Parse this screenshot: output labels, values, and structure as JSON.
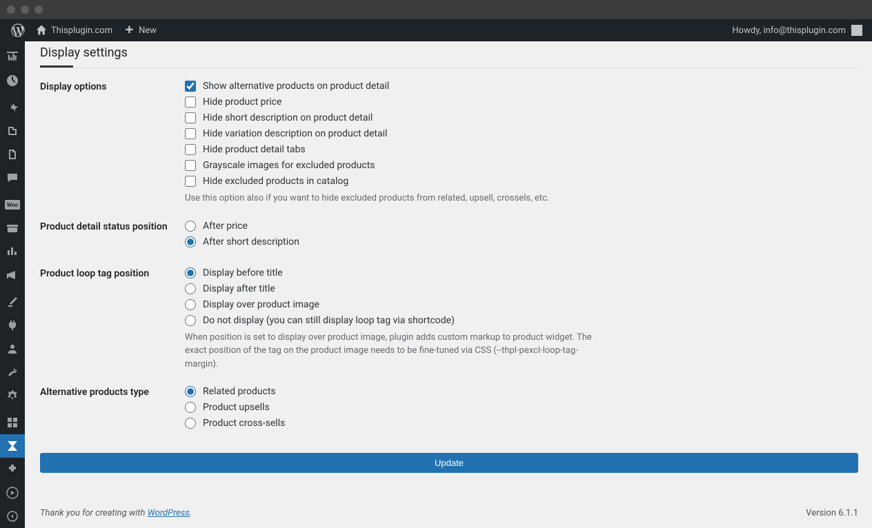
{
  "chrome": {},
  "adminbar": {
    "site_name": "Thisplugin.com",
    "new_label": "New",
    "howdy": "Howdy, info@thisplugin.com"
  },
  "page": {
    "section_title": "Display settings",
    "display_options": {
      "label": "Display options",
      "items": [
        {
          "label": "Show alternative products on product detail",
          "checked": true
        },
        {
          "label": "Hide product price",
          "checked": false
        },
        {
          "label": "Hide short description on product detail",
          "checked": false
        },
        {
          "label": "Hide variation description on product detail",
          "checked": false
        },
        {
          "label": "Hide product detail tabs",
          "checked": false
        },
        {
          "label": "Grayscale images for excluded products",
          "checked": false
        },
        {
          "label": "Hide excluded products in catalog",
          "checked": false
        }
      ],
      "help": "Use this option also if you want to hide excluded products from related, upsell, crossels, etc."
    },
    "detail_status": {
      "label": "Product detail status position",
      "options": [
        {
          "label": "After price",
          "checked": false
        },
        {
          "label": "After short description",
          "checked": true
        }
      ]
    },
    "loop_tag": {
      "label": "Product loop tag position",
      "options": [
        {
          "label": "Display before title",
          "checked": true
        },
        {
          "label": "Display after title",
          "checked": false
        },
        {
          "label": "Display over product image",
          "checked": false
        },
        {
          "label": "Do not display (you can still display loop tag via shortcode)",
          "checked": false
        }
      ],
      "help": "When position is set to display over product image, plugin adds custom markup to product widget. The exact position of the tag on the product image needs to be fine-tuned via CSS (--thpl-pexcl-loop-tag-margin)."
    },
    "alt_products": {
      "label": "Alternative products type",
      "options": [
        {
          "label": "Related products",
          "checked": true
        },
        {
          "label": "Product upsells",
          "checked": false
        },
        {
          "label": "Product cross-sells",
          "checked": false
        }
      ]
    },
    "update_button": "Update"
  },
  "footer": {
    "thanks_prefix": "Thank you for creating with ",
    "wp_link": "WordPress",
    "thanks_suffix": ".",
    "version": "Version 6.1.1"
  }
}
